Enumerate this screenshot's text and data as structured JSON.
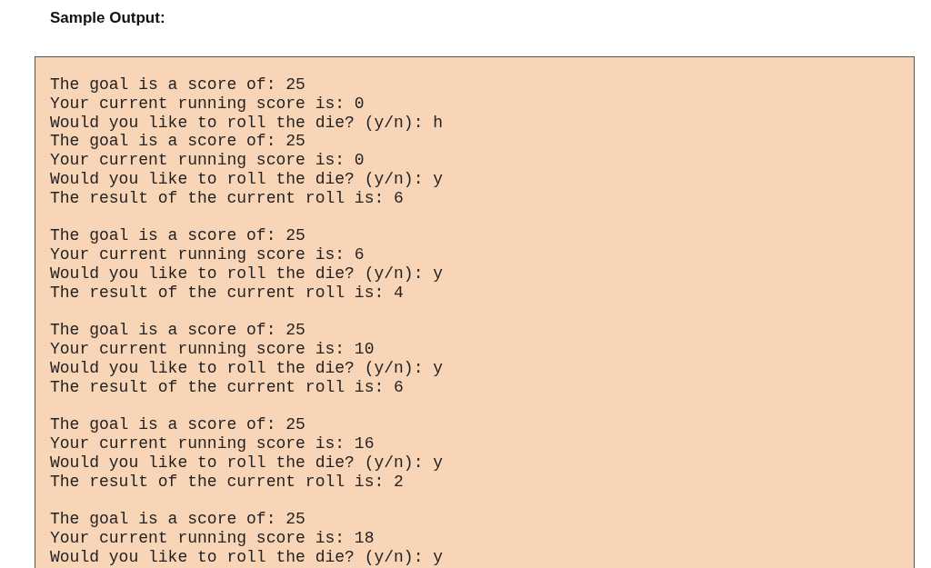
{
  "heading": "Sample Output:",
  "console": {
    "blocks": [
      {
        "lines": [
          "The goal is a score of: 25",
          "Your current running score is: 0",
          "Would you like to roll the die? (y/n): h",
          "The goal is a score of: 25",
          "Your current running score is: 0",
          "Would you like to roll the die? (y/n): y",
          "The result of the current roll is: 6"
        ]
      },
      {
        "lines": [
          "The goal is a score of: 25",
          "Your current running score is: 6",
          "Would you like to roll the die? (y/n): y",
          "The result of the current roll is: 4"
        ]
      },
      {
        "lines": [
          "The goal is a score of: 25",
          "Your current running score is: 10",
          "Would you like to roll the die? (y/n): y",
          "The result of the current roll is: 6"
        ]
      },
      {
        "lines": [
          "The goal is a score of: 25",
          "Your current running score is: 16",
          "Would you like to roll the die? (y/n): y",
          "The result of the current roll is: 2"
        ]
      },
      {
        "lines": [
          "The goal is a score of: 25",
          "Your current running score is: 18",
          "Would you like to roll the die? (y/n): y"
        ]
      }
    ]
  }
}
